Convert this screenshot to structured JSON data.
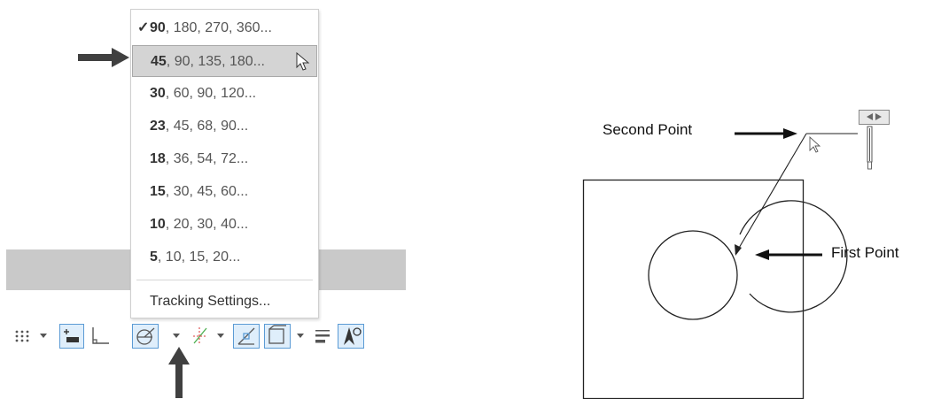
{
  "menu": {
    "items": [
      {
        "lead": "90",
        "rest": ", 180, 270, 360...",
        "checked": true
      },
      {
        "lead": "45",
        "rest": ", 90, 135, 180...",
        "highlighted": true
      },
      {
        "lead": "30",
        "rest": ", 60, 90, 120..."
      },
      {
        "lead": "23",
        "rest": ", 45, 68, 90..."
      },
      {
        "lead": "18",
        "rest": ", 36, 54, 72..."
      },
      {
        "lead": "15",
        "rest": ", 30, 45, 60..."
      },
      {
        "lead": "10",
        "rest": ", 20, 30, 40..."
      },
      {
        "lead": "5",
        "rest": ", 10, 15, 20..."
      }
    ],
    "check_mark": "✓",
    "settings_label": "Tracking Settings..."
  },
  "diagram": {
    "second_point_label": "Second Point",
    "first_point_label": "First Point"
  },
  "colors": {
    "highlight": "#d4d4d4",
    "active_button": "#dfeefb",
    "accent": "#5b9bd5"
  }
}
